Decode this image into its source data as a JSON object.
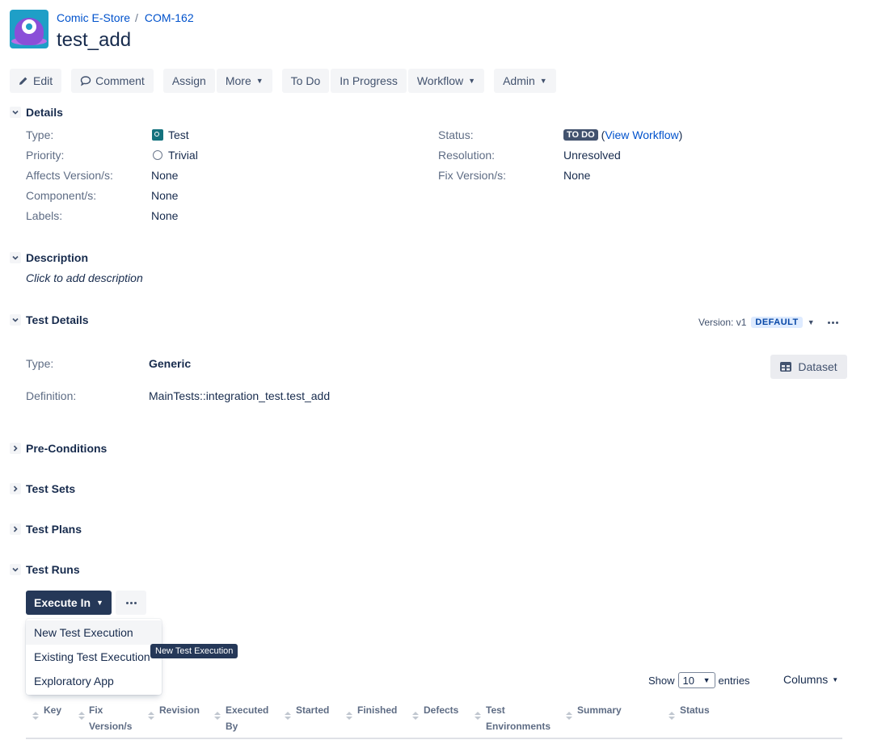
{
  "breadcrumb": {
    "project": "Comic E-Store",
    "separator": "/",
    "issue_key": "COM-162"
  },
  "issue": {
    "title": "test_add"
  },
  "toolbar": {
    "edit": "Edit",
    "comment": "Comment",
    "assign": "Assign",
    "more": "More",
    "todo": "To Do",
    "in_progress": "In Progress",
    "workflow": "Workflow",
    "admin": "Admin"
  },
  "details": {
    "heading": "Details",
    "type_label": "Type:",
    "type_value": "Test",
    "priority_label": "Priority:",
    "priority_value": "Trivial",
    "affects_label": "Affects Version/s:",
    "affects_value": "None",
    "component_label": "Component/s:",
    "component_value": "None",
    "labels_label": "Labels:",
    "labels_value": "None",
    "status_label": "Status:",
    "status_value": "TO DO",
    "status_paren_open": "(",
    "view_workflow": "View Workflow",
    "status_paren_close": ")",
    "resolution_label": "Resolution:",
    "resolution_value": "Unresolved",
    "fix_label": "Fix Version/s:",
    "fix_value": "None"
  },
  "description": {
    "heading": "Description",
    "placeholder": "Click to add description"
  },
  "test_details": {
    "heading": "Test Details",
    "version_label": "Version: v1",
    "version_badge": "DEFAULT",
    "type_label": "Type:",
    "type_value": "Generic",
    "definition_label": "Definition:",
    "definition_value": "MainTests::integration_test.test_add",
    "dataset_button": "Dataset"
  },
  "sections": {
    "preconditions": "Pre-Conditions",
    "test_sets": "Test Sets",
    "test_plans": "Test Plans",
    "test_runs": "Test Runs"
  },
  "test_runs": {
    "execute_in": "Execute In",
    "menu": [
      "New Test Execution",
      "Existing Test Execution",
      "Exploratory App"
    ],
    "tooltip": "New Test Execution",
    "show": "Show",
    "entries_value": "10",
    "entries": "entries",
    "columns": "Columns",
    "headers": {
      "key": "Key",
      "fix_1": "Fix",
      "fix_2": "Version/s",
      "revision": "Revision",
      "executed_1": "Executed",
      "executed_2": "By",
      "started": "Started",
      "finished": "Finished",
      "defects": "Defects",
      "env_1": "Test",
      "env_2": "Environments",
      "summary": "Summary",
      "status": "Status"
    }
  },
  "colors": {
    "primary_dark": "#253858",
    "link": "#0052cc",
    "test_icon": "#14727e",
    "avatar_bg": "#1f9fc7"
  }
}
